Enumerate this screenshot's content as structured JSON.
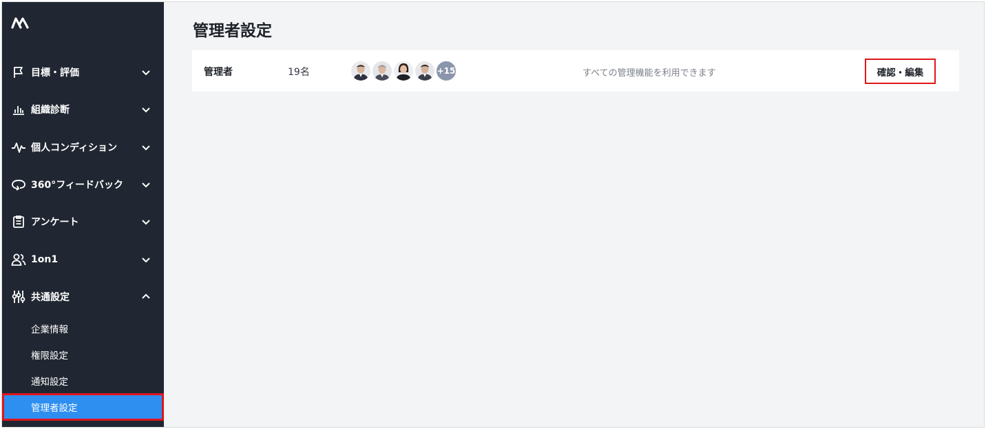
{
  "sidebar": {
    "items": [
      {
        "label": "目標・評価",
        "icon": "flag-icon",
        "expanded": false
      },
      {
        "label": "組織診断",
        "icon": "bar-chart-icon",
        "expanded": false
      },
      {
        "label": "個人コンディション",
        "icon": "pulse-icon",
        "expanded": false
      },
      {
        "label": "360°フィードバック",
        "icon": "feedback-loop-icon",
        "expanded": false
      },
      {
        "label": "アンケート",
        "icon": "clipboard-icon",
        "expanded": false
      },
      {
        "label": "1on1",
        "icon": "users-icon",
        "expanded": false
      },
      {
        "label": "共通設定",
        "icon": "sliders-icon",
        "expanded": true
      }
    ],
    "sub_items": [
      {
        "label": "企業情報",
        "active": false
      },
      {
        "label": "権限設定",
        "active": false
      },
      {
        "label": "通知設定",
        "active": false
      },
      {
        "label": "管理者設定",
        "active": true
      }
    ]
  },
  "main": {
    "title": "管理者設定",
    "row": {
      "role": "管理者",
      "count": "19名",
      "more_badge": "+15",
      "description": "すべての管理機能を利用できます",
      "edit_button": "確認・編集"
    }
  },
  "colors": {
    "sidebar_bg": "#202732",
    "active_bg": "#2e8ff0",
    "highlight_border": "#e0151b",
    "content_bg": "#f3f4f6"
  }
}
